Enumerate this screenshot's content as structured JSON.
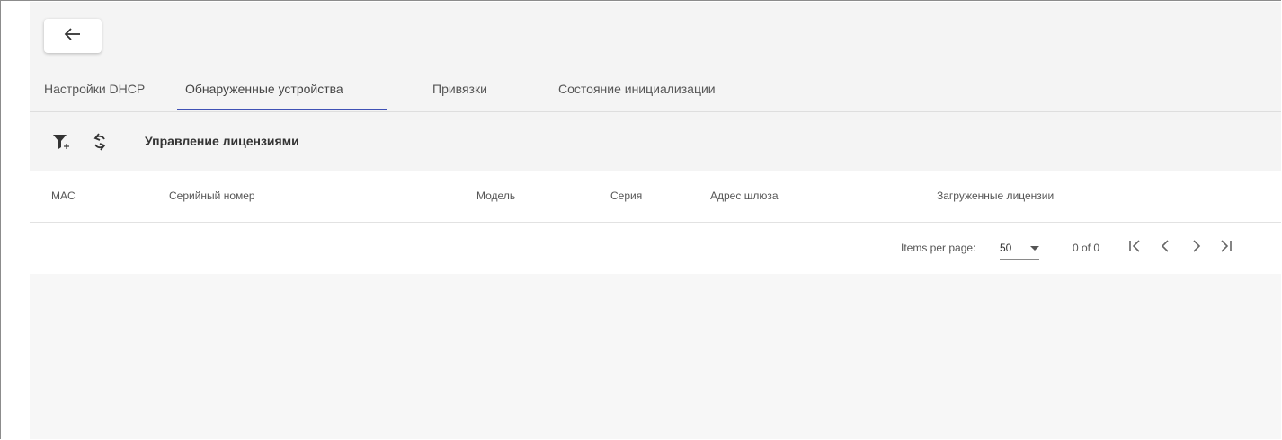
{
  "header": {
    "back_icon": "arrow-left-icon"
  },
  "tabs": [
    {
      "label": "Настройки DHCP",
      "active": false
    },
    {
      "label": "Обнаруженные устройства",
      "active": true
    },
    {
      "label": "Привязки",
      "active": false
    },
    {
      "label": "Состояние инициализации",
      "active": false
    }
  ],
  "toolbar": {
    "filter_icon": "filter-add-icon",
    "refresh_icon": "refresh-icon",
    "title": "Управление лицензиями"
  },
  "table": {
    "columns": [
      "MAC",
      "Серийный номер",
      "Модель",
      "Серия",
      "Адрес шлюза",
      "Загруженные лицензии"
    ],
    "rows": []
  },
  "paginator": {
    "items_per_page_label": "Items per page:",
    "page_size": "50",
    "range_label": "0 of 0",
    "first_icon": "first-page-icon",
    "prev_icon": "chevron-left-icon",
    "next_icon": "chevron-right-icon",
    "last_icon": "last-page-icon"
  },
  "colors": {
    "accent": "#3f51b5",
    "panel": "#f4f4f4"
  }
}
